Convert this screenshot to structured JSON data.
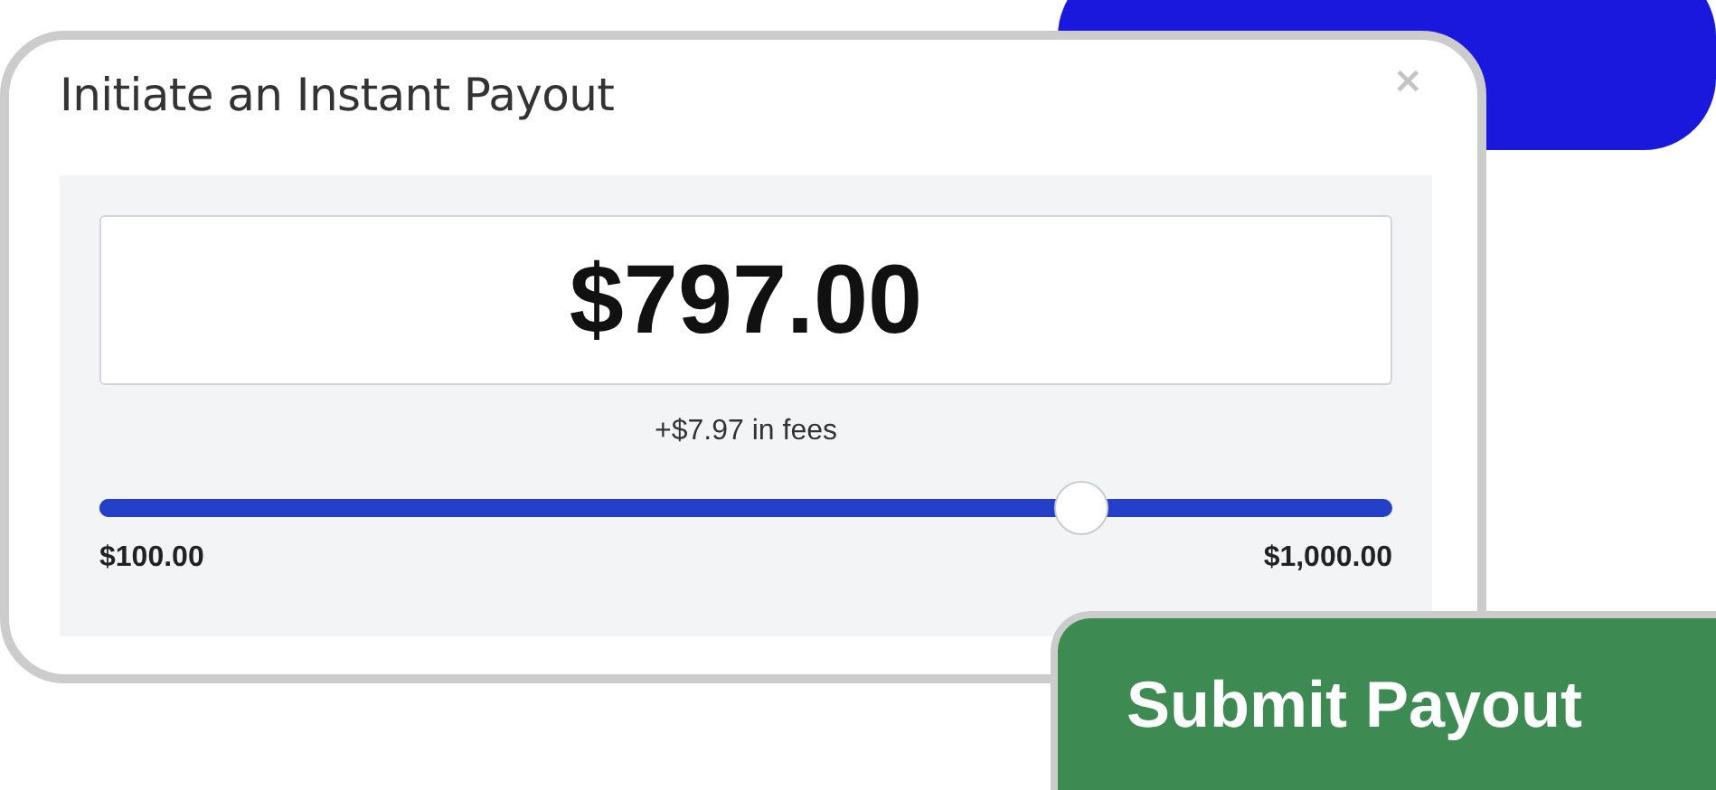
{
  "dialog": {
    "title": "Initiate an Instant Payout",
    "close": "×",
    "amount": "$797.00",
    "fees": "+$7.97 in fees",
    "slider": {
      "level": 0.76,
      "min_label": "$100.00",
      "max_label": "$1,000.00"
    }
  },
  "submit_button": "Submit Payout"
}
